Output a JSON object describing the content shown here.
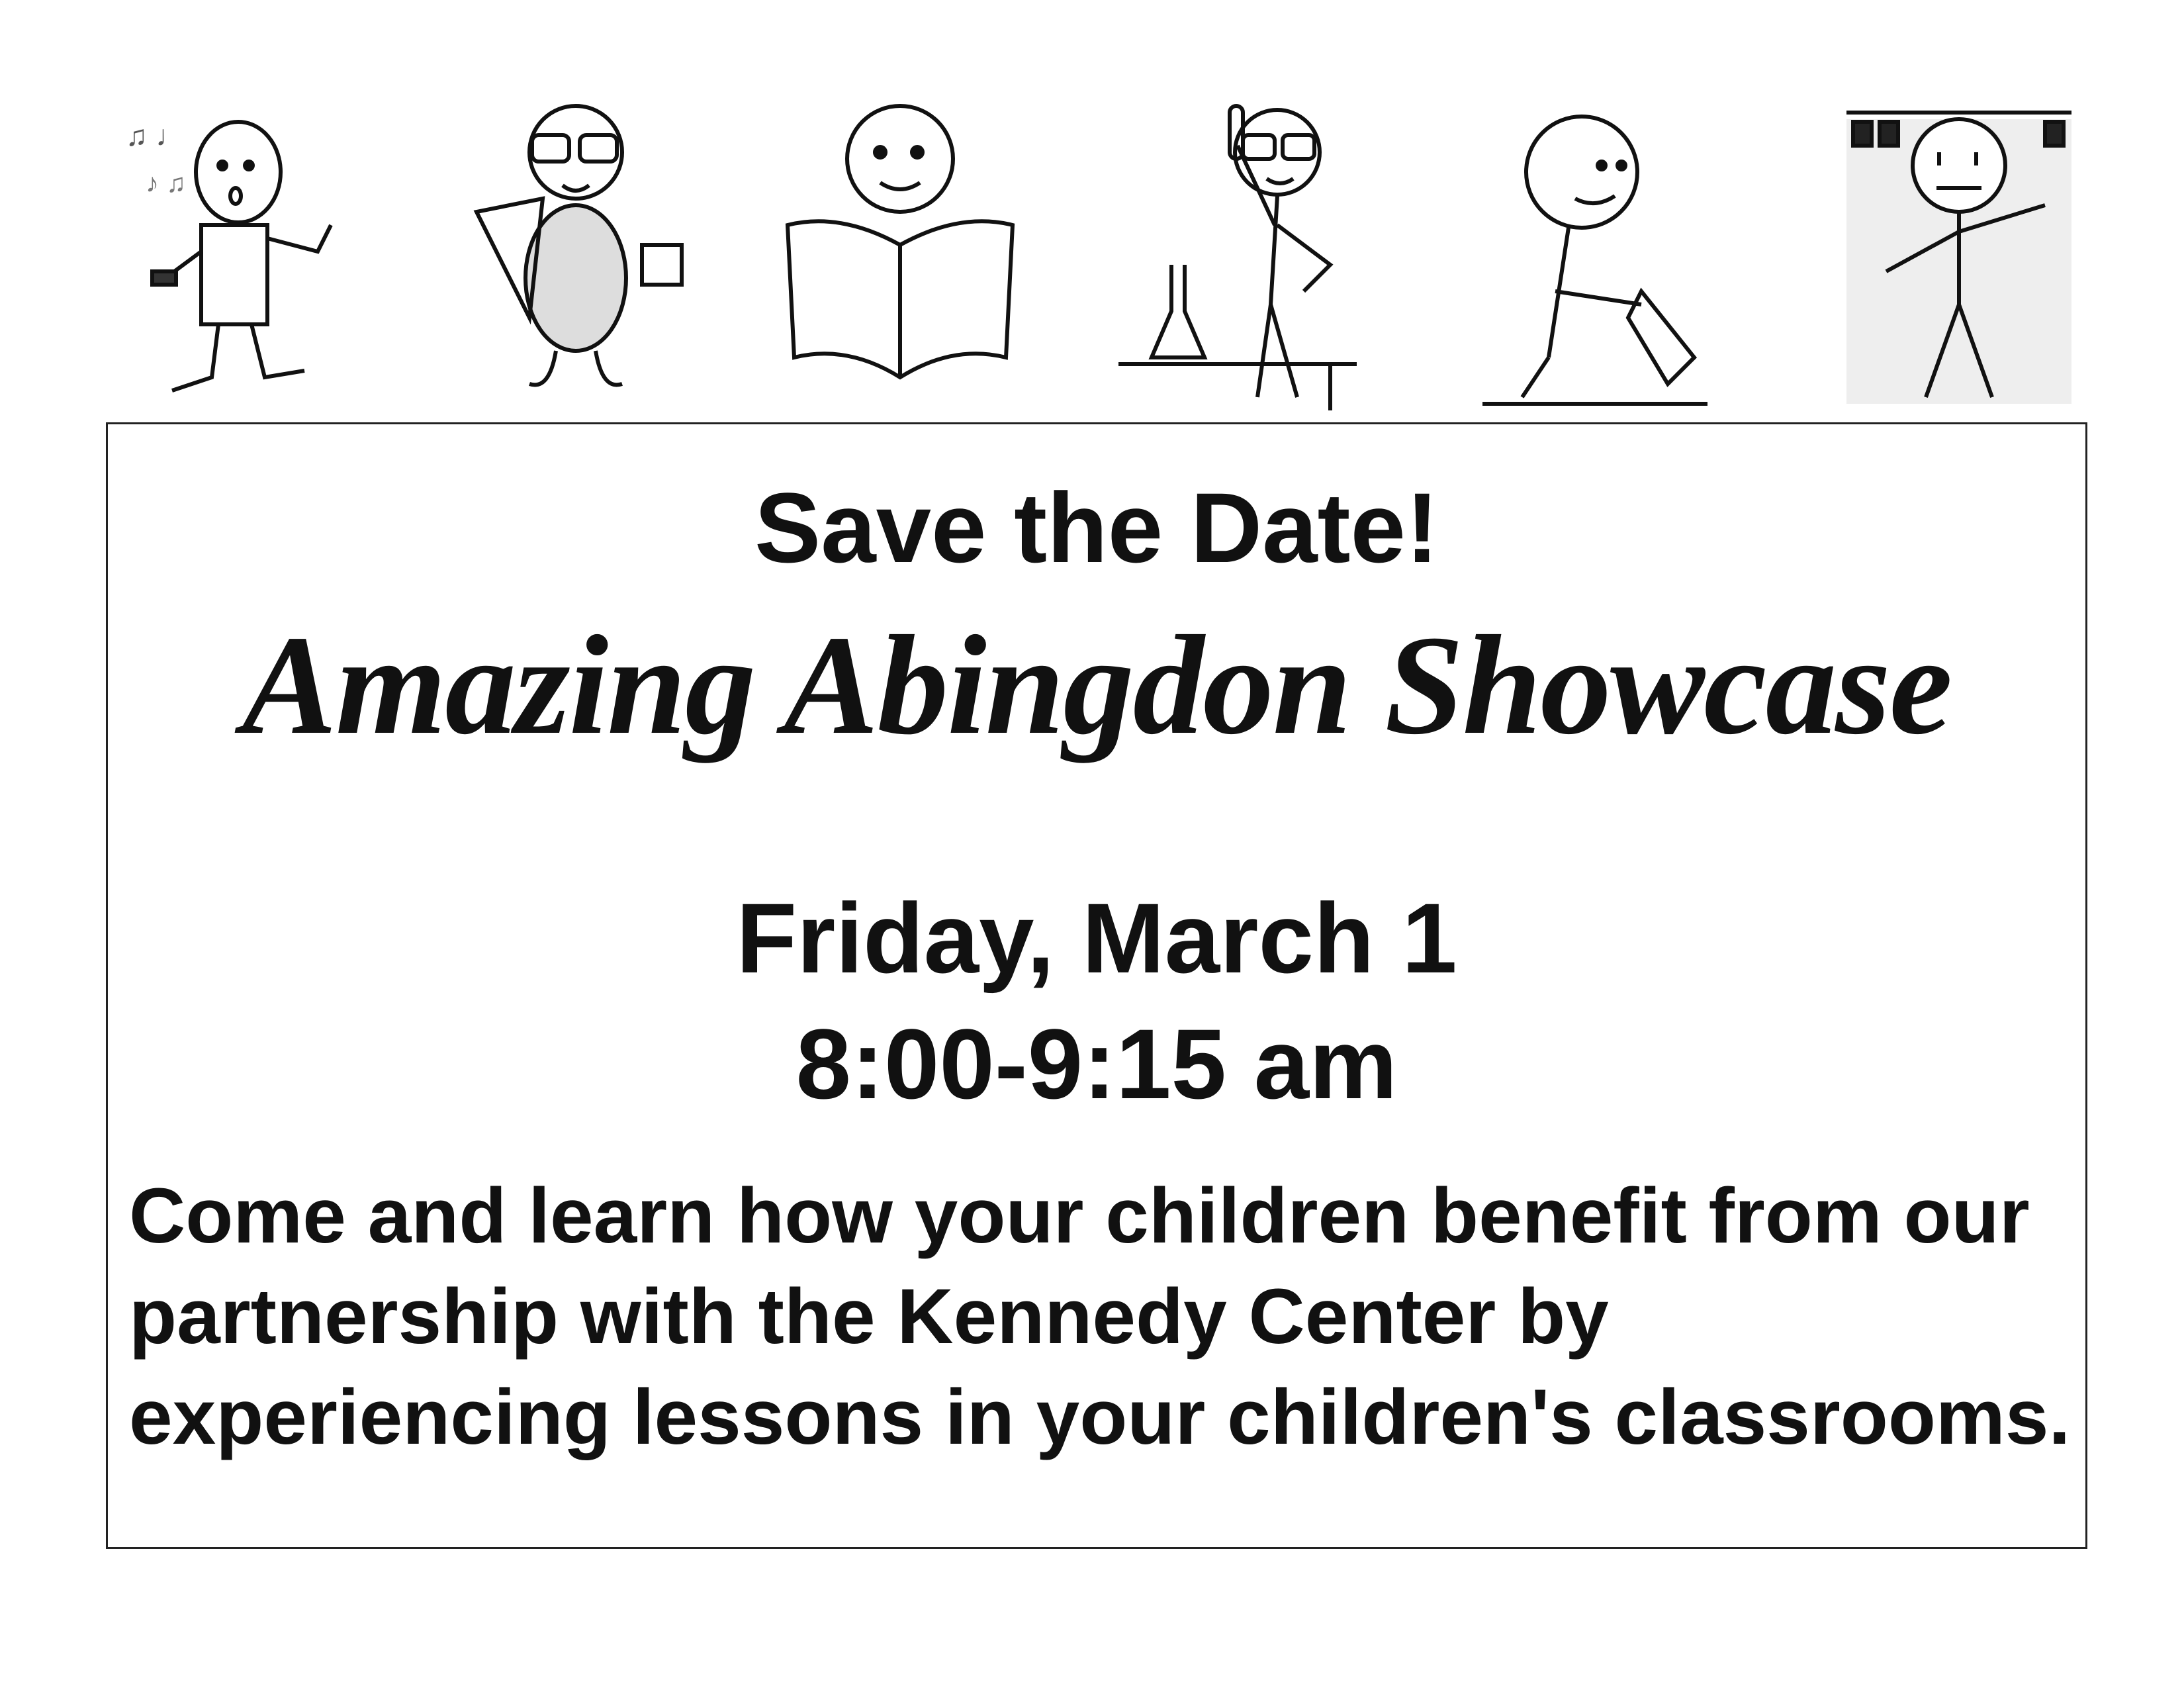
{
  "illustrations": [
    "singing-figure",
    "math-figure",
    "reading-figure",
    "science-figure",
    "writing-figure",
    "stage-figure"
  ],
  "flyer": {
    "heading": "Save the Date!",
    "event_title": "Amazing Abingdon Showcase",
    "date": "Friday, March 1",
    "time": "8:00-9:15 am",
    "description_lines": [
      "Come and learn how your children benefit from our",
      "partnership with the Kennedy Center by",
      "experiencing lessons in your children's classrooms."
    ]
  }
}
